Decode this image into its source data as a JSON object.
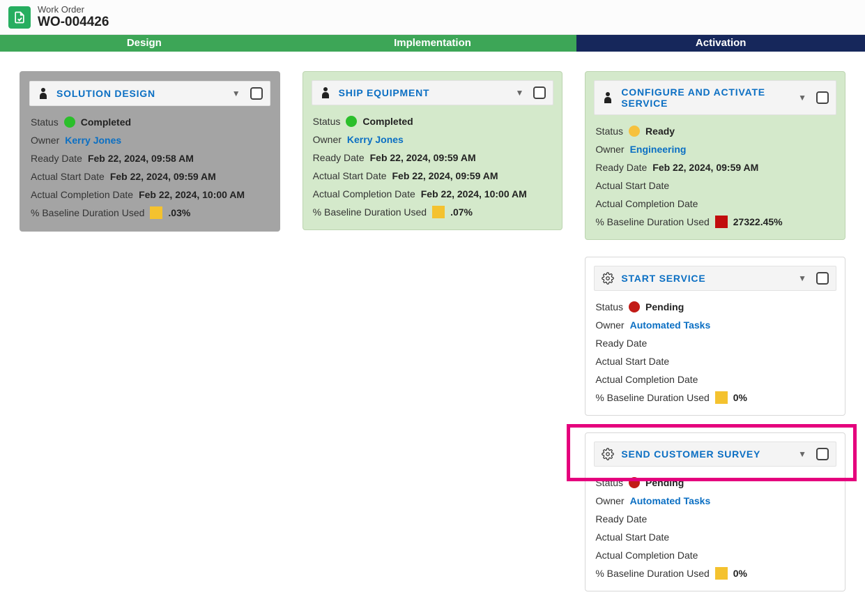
{
  "header": {
    "type_label": "Work Order",
    "id": "WO-004426"
  },
  "phases": [
    {
      "label": "Design",
      "tone": "green"
    },
    {
      "label": "Implementation",
      "tone": "green"
    },
    {
      "label": "Activation",
      "tone": "dark"
    }
  ],
  "field_labels": {
    "status": "Status",
    "owner": "Owner",
    "ready_date": "Ready Date",
    "actual_start": "Actual Start Date",
    "actual_completion": "Actual Completion Date",
    "pct_baseline": "% Baseline Duration Used"
  },
  "cards": {
    "solution_design": {
      "title": "SOLUTION DESIGN",
      "icon": "person",
      "status": "Completed",
      "status_color": "green",
      "owner": "Kerry Jones",
      "ready_date": "Feb 22, 2024, 09:58 AM",
      "actual_start": "Feb 22, 2024, 09:59 AM",
      "actual_completion": "Feb 22, 2024, 10:00 AM",
      "pct_baseline": ".03%",
      "pct_color": "yellow",
      "card_tone": "completed-bg"
    },
    "ship_equipment": {
      "title": "SHIP EQUIPMENT",
      "icon": "person",
      "status": "Completed",
      "status_color": "green",
      "owner": "Kerry Jones",
      "ready_date": "Feb 22, 2024, 09:59 AM",
      "actual_start": "Feb 22, 2024, 09:59 AM",
      "actual_completion": "Feb 22, 2024, 10:00 AM",
      "pct_baseline": ".07%",
      "pct_color": "yellow",
      "card_tone": "completed-green"
    },
    "configure_activate": {
      "title": "CONFIGURE AND ACTIVATE SERVICE",
      "icon": "person",
      "status": "Ready",
      "status_color": "yellow",
      "owner": "Engineering",
      "ready_date": "Feb 22, 2024, 09:59 AM",
      "actual_start": "",
      "actual_completion": "",
      "pct_baseline": "27322.45%",
      "pct_color": "red",
      "card_tone": "completed-green"
    },
    "start_service": {
      "title": "START SERVICE",
      "icon": "gear",
      "status": "Pending",
      "status_color": "red",
      "owner": "Automated Tasks",
      "ready_date": "",
      "actual_start": "",
      "actual_completion": "",
      "pct_baseline": "0%",
      "pct_color": "yellow",
      "card_tone": "pending-bg"
    },
    "send_survey": {
      "title": "SEND CUSTOMER SURVEY",
      "icon": "gear",
      "status": "Pending",
      "status_color": "red",
      "owner": "Automated Tasks",
      "ready_date": "",
      "actual_start": "",
      "actual_completion": "",
      "pct_baseline": "0%",
      "pct_color": "yellow",
      "card_tone": "pending-bg"
    }
  }
}
